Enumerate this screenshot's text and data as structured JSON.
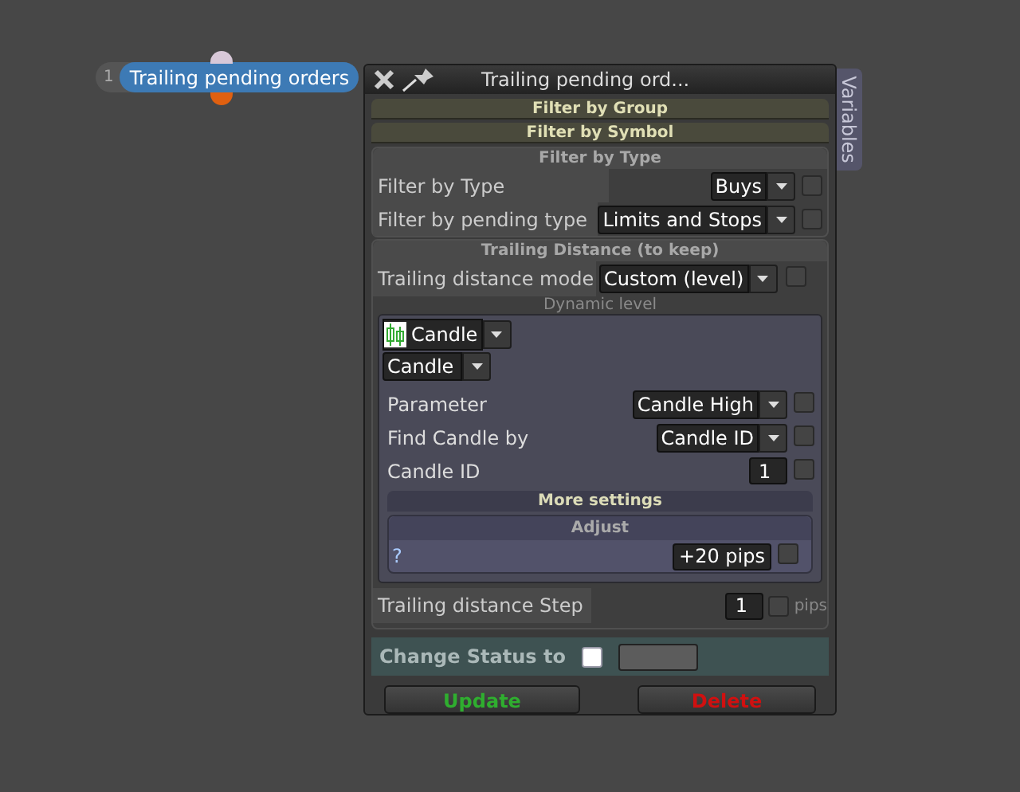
{
  "node": {
    "number": "1",
    "label": "Trailing pending orders"
  },
  "window": {
    "title": "Trailing pending ord...",
    "side_tab": "Variables"
  },
  "collapsed_sections": [
    "Filter by Group",
    "Filter by Symbol"
  ],
  "filter_by_type": {
    "title": "Filter by Type",
    "rows": [
      {
        "label": "Filter by Type",
        "value": "Buys",
        "checked": false
      },
      {
        "label": "Filter by pending type",
        "value": "Limits and Stops",
        "checked": false
      }
    ]
  },
  "trailing_distance": {
    "title": "Trailing Distance (to keep)",
    "mode": {
      "label": "Trailing distance mode",
      "value": "Custom (level)",
      "checked": false
    },
    "dynamic_level": {
      "title": "Dynamic level",
      "source": "Candle",
      "sub_source": "Candle",
      "rows": [
        {
          "kind": "select",
          "label": "Parameter",
          "value": "Candle High",
          "checked": false
        },
        {
          "kind": "select",
          "label": "Find Candle by",
          "value": "Candle ID",
          "checked": false
        },
        {
          "kind": "number",
          "label": "Candle ID",
          "value": "1",
          "checked": false
        }
      ],
      "more_settings": "More settings",
      "adjust": {
        "title": "Adjust",
        "label": "?",
        "value": "+20 pips",
        "checked": false
      }
    },
    "step": {
      "label": "Trailing distance Step",
      "value": "1",
      "checked": false,
      "unit": "pips"
    }
  },
  "change_status": {
    "label": "Change Status to",
    "checked": false
  },
  "buttons": [
    {
      "label": "Update",
      "kind": "update"
    },
    {
      "label": "Delete",
      "kind": "delete"
    }
  ]
}
